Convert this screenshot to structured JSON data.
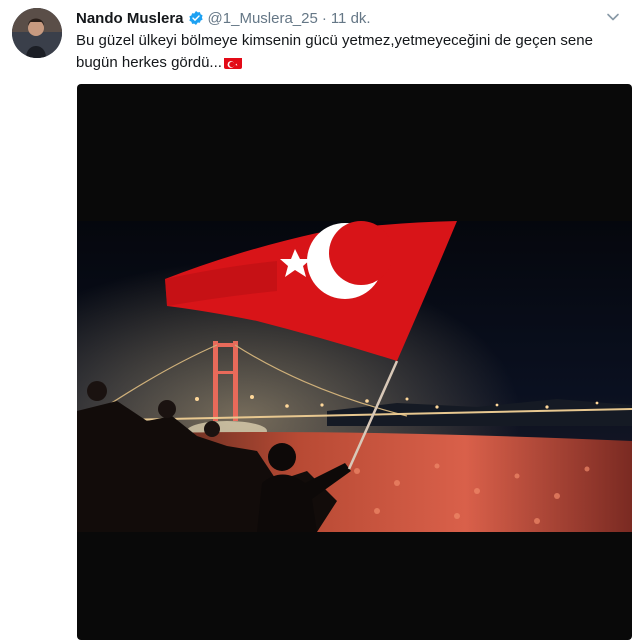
{
  "tweet": {
    "author_name": "Nando Muslera",
    "author_handle": "@1_Muslera_25",
    "separator": "·",
    "timestamp": "11 dk.",
    "text": "Bu güzel ülkeyi bölmeye kimsenin gücü yetmez,yetmeyeceğini de geçen sene bugün herkes gördü...",
    "text_emoji": "turkish-flag-icon",
    "verified": true
  },
  "media": {
    "type": "photo",
    "subject": "turkish-flag-waving-over-bosphorus-bridge-crowd"
  },
  "colors": {
    "verified_blue": "#1da1f2",
    "muted_text": "#657786",
    "flag_red": "#e30a17",
    "media_background": "#090909"
  }
}
